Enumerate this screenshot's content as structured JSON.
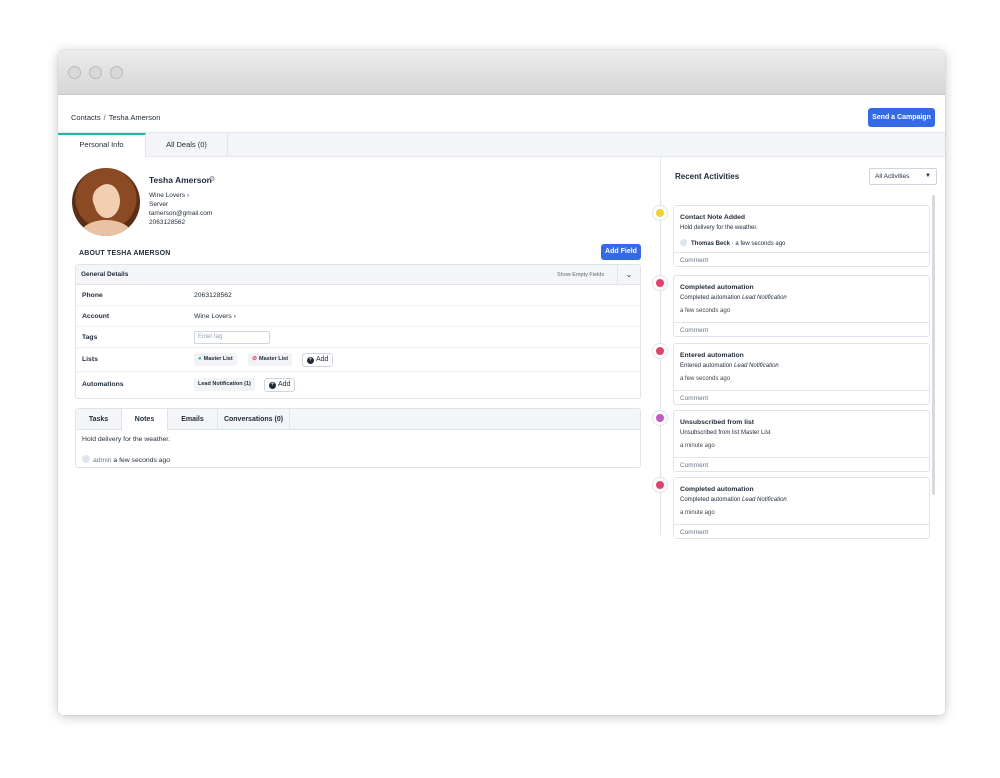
{
  "breadcrumb": {
    "root": "Contacts",
    "separator": "/",
    "current": "Tesha Amerson"
  },
  "header": {
    "send_campaign_label": "Send a Campaign"
  },
  "profile_tabs": [
    "Personal Info",
    "All Deals (0)"
  ],
  "contact": {
    "name": "Tesha Amerson",
    "account": "Wine Lovers",
    "title": "Server",
    "email": "tamerson@gmail.com",
    "phone": "2063128562"
  },
  "about": {
    "heading": "ABOUT TESHA AMERSON",
    "add_field_label": "Add Field"
  },
  "general_details": {
    "title": "General Details",
    "show_empty_label": "Show Empty Fields",
    "fields": {
      "phone_label": "Phone",
      "phone_value": "2063128562",
      "account_label": "Account",
      "account_value": "Wine Lovers",
      "tags_label": "Tags",
      "tags_placeholder": "Enter tag",
      "lists_label": "Lists",
      "list_1": "Master List",
      "list_2": "Master List",
      "lists_add": "Add",
      "automations_label": "Automations",
      "automation_1": "Lead Notification (1)",
      "automations_add": "Add"
    }
  },
  "notes_tabs": [
    "Tasks",
    "Notes",
    "Emails",
    "Conversations (0)"
  ],
  "note": {
    "text": "Hold delivery for the weather.",
    "author": "admin",
    "time": "a few seconds ago"
  },
  "activities": {
    "title": "Recent Activities",
    "filter": "All Activities",
    "comment_label": "Comment",
    "items": [
      {
        "title": "Contact Note Added",
        "desc": "Hold delivery for the weather.",
        "by": "Thomas Beck",
        "time": "· a few seconds ago",
        "color": "#f2d12e"
      },
      {
        "title": "Completed automation",
        "desc": "Completed automation",
        "desc_em": "Lead Notification",
        "time": "a few seconds ago",
        "color": "#e0426b"
      },
      {
        "title": "Entered automation",
        "desc": "Entered automation",
        "desc_em": "Lead Notification",
        "time": "a few seconds ago",
        "color": "#e0426b"
      },
      {
        "title": "Unsubscribed from list",
        "desc": "Unsubscribed from list Master List",
        "time": "a minute ago",
        "color": "#c458c9"
      },
      {
        "title": "Completed automation",
        "desc": "Completed automation",
        "desc_em": "Lead Notification",
        "time": "a minute ago",
        "color": "#e0426b"
      }
    ]
  },
  "icons": {
    "gear": "gear-icon",
    "chevron": "chevron-right-icon",
    "check": "check-circle-icon",
    "block": "block-icon",
    "plus": "plus-circle-icon"
  }
}
